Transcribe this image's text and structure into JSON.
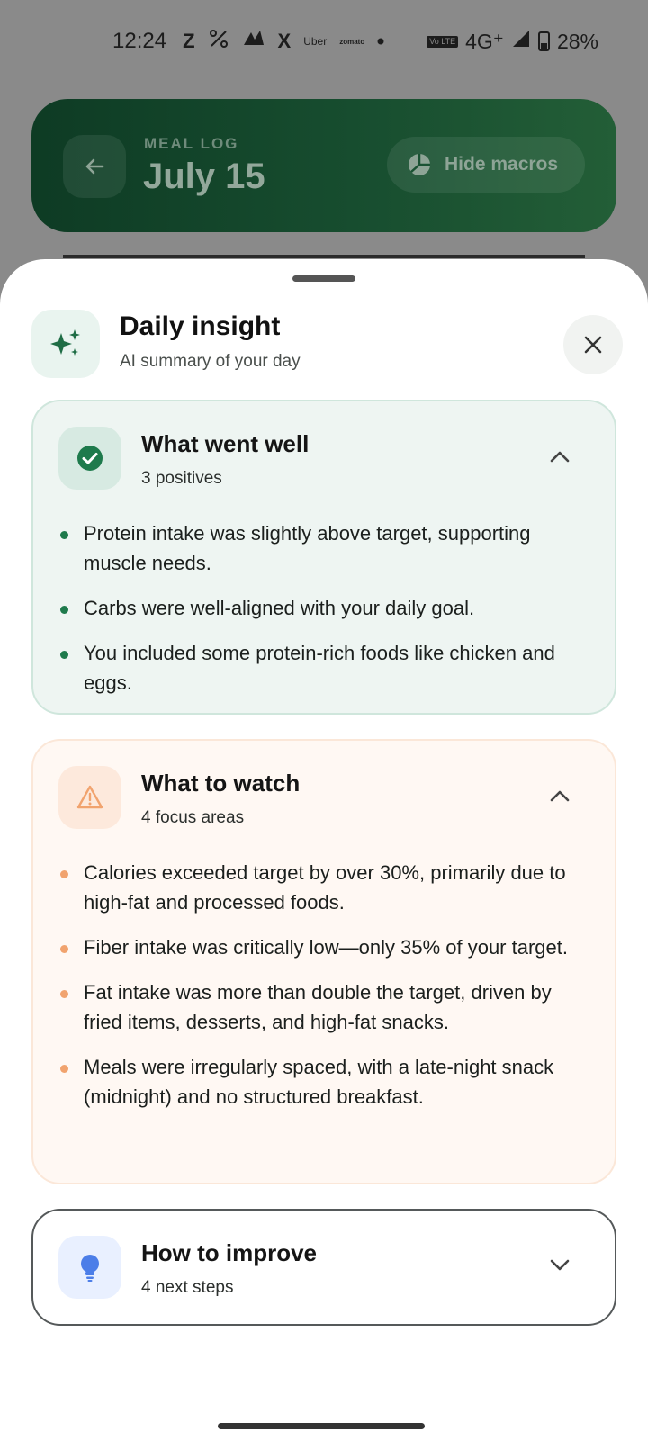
{
  "status_bar": {
    "time": "12:24",
    "app_icons": [
      "Z",
      "X"
    ],
    "small_labels": [
      "Uber",
      "zomato"
    ],
    "network": "4G⁺",
    "volte": "Vo LTE",
    "battery": "28%"
  },
  "header": {
    "eyebrow": "MEAL LOG",
    "title": "July 15",
    "macro_button": "Hide macros"
  },
  "sheet": {
    "title": "Daily insight",
    "subtitle": "AI summary of your day"
  },
  "sections": {
    "went_well": {
      "title": "What went well",
      "count": "3 positives",
      "items": [
        "Protein intake was slightly above target, supporting muscle needs.",
        "Carbs were well-aligned with your daily goal.",
        "You included some protein-rich foods like chicken and eggs."
      ]
    },
    "to_watch": {
      "title": "What to watch",
      "count": "4 focus areas",
      "items": [
        "Calories exceeded target by over 30%, primarily due to high-fat and processed foods.",
        "Fiber intake was critically low—only 35% of your target.",
        "Fat intake was more than double the target, driven by fried items, desserts, and high-fat snacks.",
        "Meals were irregularly spaced, with a late-night snack (midnight) and no structured breakfast."
      ]
    },
    "improve": {
      "title": "How to improve",
      "count": "4 next steps"
    }
  },
  "colors": {
    "good_accent": "#1e7a4c",
    "watch_accent": "#f1a36e",
    "improve_accent": "#4c7ee8",
    "header_green": "#174d2f"
  }
}
